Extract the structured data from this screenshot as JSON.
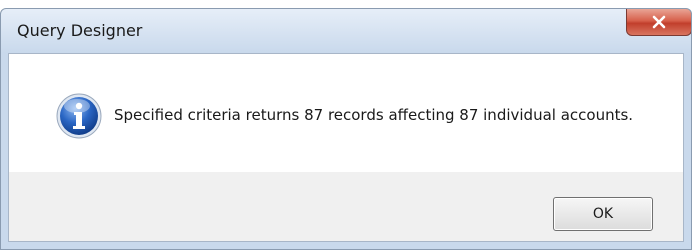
{
  "window": {
    "title": "Query Designer",
    "close_icon": "close-icon"
  },
  "dialog": {
    "icon": "info-icon",
    "message": "Specified criteria returns 87 records affecting 87 individual accounts.",
    "ok_label": "OK"
  },
  "colors": {
    "titlebar": "#c9d9ec",
    "close_button": "#c94a36",
    "info_icon": "#1f5fbf",
    "content_background": "#ffffff",
    "footer_background": "#f0f0f0"
  }
}
